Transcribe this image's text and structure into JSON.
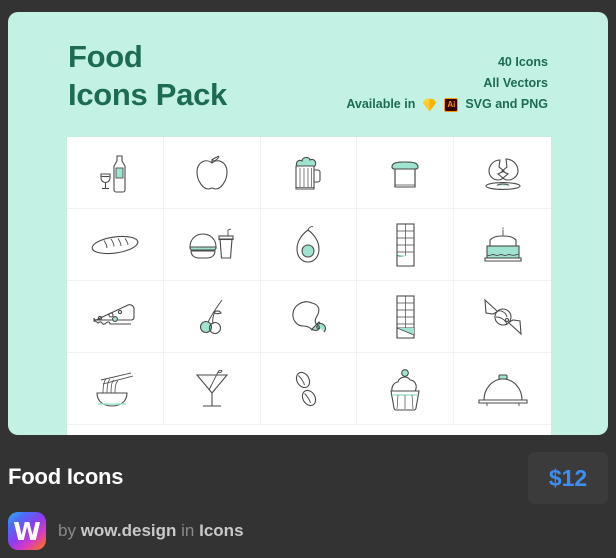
{
  "card": {
    "background_color": "#c3f2e4",
    "title": "Food\nIcons Pack",
    "meta": {
      "count": "40 Icons",
      "vectors": "All Vectors",
      "available_label": "Available in",
      "formats": "SVG and PNG",
      "format_icons": [
        "sketch-icon",
        "adobe-illustrator-icon"
      ],
      "ai_badge_text": "Ai"
    }
  },
  "grid": {
    "columns": 5,
    "rows": 4,
    "icons": [
      {
        "name": "wine-bottle-glass-icon",
        "label": "Wine bottle and glass"
      },
      {
        "name": "apple-icon",
        "label": "Apple"
      },
      {
        "name": "beer-mug-icon",
        "label": "Beer mug"
      },
      {
        "name": "bread-loaf-slice-icon",
        "label": "Sliced bread"
      },
      {
        "name": "cracked-egg-icon",
        "label": "Cracked egg"
      },
      {
        "name": "baguette-icon",
        "label": "Baguette"
      },
      {
        "name": "burger-drink-icon",
        "label": "Burger and soda"
      },
      {
        "name": "avocado-icon",
        "label": "Avocado"
      },
      {
        "name": "chocolate-bar-icon",
        "label": "Chocolate bar"
      },
      {
        "name": "birthday-cake-icon",
        "label": "Birthday cake"
      },
      {
        "name": "cheese-wedge-icon",
        "label": "Cheese wedge"
      },
      {
        "name": "cherries-icon",
        "label": "Cherries"
      },
      {
        "name": "chicken-drumstick-icon",
        "label": "Chicken drumstick"
      },
      {
        "name": "chocolate-bar-half-icon",
        "label": "Chocolate bar half"
      },
      {
        "name": "wrapped-candy-icon",
        "label": "Wrapped candy"
      },
      {
        "name": "noodle-bowl-icon",
        "label": "Noodle bowl with chopsticks"
      },
      {
        "name": "cocktail-glass-icon",
        "label": "Cocktail glass"
      },
      {
        "name": "coffee-beans-icon",
        "label": "Coffee beans"
      },
      {
        "name": "cupcake-icon",
        "label": "Cupcake"
      },
      {
        "name": "cloche-platter-icon",
        "label": "Serving cloche"
      }
    ]
  },
  "footer": {
    "product_title": "Food Icons",
    "price": "$12",
    "price_color": "#3d8ef0",
    "avatar_letter": "W",
    "byline": {
      "by": "by",
      "author": "wow.design",
      "in": "in",
      "category": "Icons"
    }
  }
}
